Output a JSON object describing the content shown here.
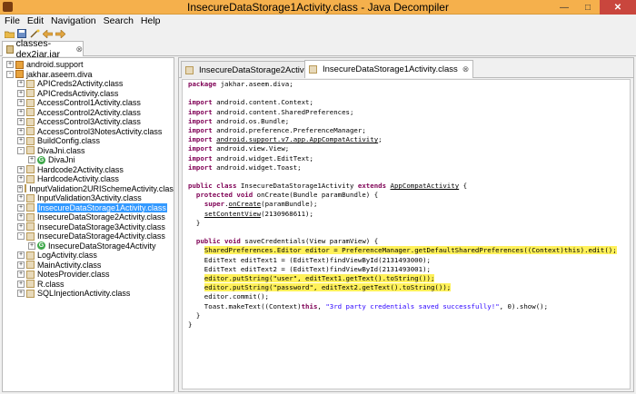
{
  "window": {
    "title": "InsecureDataStorage1Activity.class - Java Decompiler"
  },
  "menu": [
    "File",
    "Edit",
    "Navigation",
    "Search",
    "Help"
  ],
  "file_tab": {
    "label": "classes-dex2jar.jar"
  },
  "tree": [
    {
      "label": "android.support",
      "type": "package",
      "depth": 0,
      "expander": "+"
    },
    {
      "label": "jakhar.aseem.diva",
      "type": "package",
      "depth": 0,
      "expander": "-"
    },
    {
      "label": "APICreds2Activity.class",
      "type": "class",
      "depth": 1,
      "expander": "+"
    },
    {
      "label": "APICredsActivity.class",
      "type": "class",
      "depth": 1,
      "expander": "+"
    },
    {
      "label": "AccessControl1Activity.class",
      "type": "class",
      "depth": 1,
      "expander": "+"
    },
    {
      "label": "AccessControl2Activity.class",
      "type": "class",
      "depth": 1,
      "expander": "+"
    },
    {
      "label": "AccessControl3Activity.class",
      "type": "class",
      "depth": 1,
      "expander": "+"
    },
    {
      "label": "AccessControl3NotesActivity.class",
      "type": "class",
      "depth": 1,
      "expander": "+"
    },
    {
      "label": "BuildConfig.class",
      "type": "class",
      "depth": 1,
      "expander": "+"
    },
    {
      "label": "DivaJni.class",
      "type": "class",
      "depth": 1,
      "expander": "-"
    },
    {
      "label": "DivaJni",
      "type": "g",
      "depth": 2,
      "expander": "+"
    },
    {
      "label": "Hardcode2Activity.class",
      "type": "class",
      "depth": 1,
      "expander": "+"
    },
    {
      "label": "HardcodeActivity.class",
      "type": "class",
      "depth": 1,
      "expander": "+"
    },
    {
      "label": "InputValidation2URISchemeActivity.class",
      "type": "class",
      "depth": 1,
      "expander": "+"
    },
    {
      "label": "InputValidation3Activity.class",
      "type": "class",
      "depth": 1,
      "expander": "+"
    },
    {
      "label": "InsecureDataStorage1Activity.class",
      "type": "class",
      "depth": 1,
      "expander": "+",
      "selected": true
    },
    {
      "label": "InsecureDataStorage2Activity.class",
      "type": "class",
      "depth": 1,
      "expander": "+"
    },
    {
      "label": "InsecureDataStorage3Activity.class",
      "type": "class",
      "depth": 1,
      "expander": "+"
    },
    {
      "label": "InsecureDataStorage4Activity.class",
      "type": "class",
      "depth": 1,
      "expander": "-"
    },
    {
      "label": "InsecureDataStorage4Activity",
      "type": "g",
      "depth": 2,
      "expander": "+"
    },
    {
      "label": "LogActivity.class",
      "type": "class",
      "depth": 1,
      "expander": "+"
    },
    {
      "label": "MainActivity.class",
      "type": "class",
      "depth": 1,
      "expander": "+"
    },
    {
      "label": "NotesProvider.class",
      "type": "class",
      "depth": 1,
      "expander": "+"
    },
    {
      "label": "R.class",
      "type": "class",
      "depth": 1,
      "expander": "+"
    },
    {
      "label": "SQLInjectionActivity.class",
      "type": "class",
      "depth": 1,
      "expander": "+"
    }
  ],
  "editor_tabs": [
    {
      "label": "InsecureDataStorage2Activity.class",
      "active": false
    },
    {
      "label": "InsecureDataStorage1Activity.class",
      "active": true
    }
  ],
  "code_lines": [
    [
      {
        "t": "package",
        "k": "kw"
      },
      {
        "t": " jakhar.aseem.diva;"
      }
    ],
    [],
    [
      {
        "t": "import",
        "k": "kw"
      },
      {
        "t": " android.content.Context;"
      }
    ],
    [
      {
        "t": "import",
        "k": "kw"
      },
      {
        "t": " android.content.SharedPreferences;"
      }
    ],
    [
      {
        "t": "import",
        "k": "kw"
      },
      {
        "t": " android.os.Bundle;"
      }
    ],
    [
      {
        "t": "import",
        "k": "kw"
      },
      {
        "t": " android.preference.PreferenceManager;"
      }
    ],
    [
      {
        "t": "import",
        "k": "kw"
      },
      {
        "t": " "
      },
      {
        "t": "android.support.v7.app.AppCompatActivity",
        "k": "lnk"
      },
      {
        "t": ";"
      }
    ],
    [
      {
        "t": "import",
        "k": "kw"
      },
      {
        "t": " android.view.View;"
      }
    ],
    [
      {
        "t": "import",
        "k": "kw"
      },
      {
        "t": " android.widget.EditText;"
      }
    ],
    [
      {
        "t": "import",
        "k": "kw"
      },
      {
        "t": " android.widget.Toast;"
      }
    ],
    [],
    [
      {
        "t": "public class",
        "k": "kw"
      },
      {
        "t": " InsecureDataStorage1Activity "
      },
      {
        "t": "extends",
        "k": "kw"
      },
      {
        "t": " "
      },
      {
        "t": "AppCompatActivity",
        "k": "lnk"
      },
      {
        "t": " {"
      }
    ],
    [
      {
        "t": "  "
      },
      {
        "t": "protected void",
        "k": "kw"
      },
      {
        "t": " onCreate(Bundle paramBundle) {"
      }
    ],
    [
      {
        "t": "    "
      },
      {
        "t": "super",
        "k": "kw"
      },
      {
        "t": "."
      },
      {
        "t": "onCreate",
        "k": "lnk"
      },
      {
        "t": "(paramBundle);"
      }
    ],
    [
      {
        "t": "    "
      },
      {
        "t": "setContentView",
        "k": "lnk"
      },
      {
        "t": "(2130968611);"
      }
    ],
    [
      {
        "t": "  }"
      }
    ],
    [],
    [
      {
        "t": "  "
      },
      {
        "t": "public void",
        "k": "kw"
      },
      {
        "t": " saveCredentials(View paramView) {"
      }
    ],
    [
      {
        "t": "    "
      },
      {
        "t": "SharedPreferences.Editor editor = PreferenceManager.getDefaultSharedPreferences((Context)this).edit();",
        "k": "hl"
      }
    ],
    [
      {
        "t": "    EditText editText1 = (EditText)findViewById(2131493000);"
      }
    ],
    [
      {
        "t": "    EditText editText2 = (EditText)findViewById(2131493001);"
      }
    ],
    [
      {
        "t": "    "
      },
      {
        "t": "editor.putString(\"user\", editText1.getText().toString());",
        "k": "hl"
      }
    ],
    [
      {
        "t": "    "
      },
      {
        "t": "editor.putString(\"password\", editText2.getText().toString());",
        "k": "hl"
      }
    ],
    [
      {
        "t": "    editor.commit();"
      }
    ],
    [
      {
        "t": "    Toast.makeText((Context)"
      },
      {
        "t": "this",
        "k": "kw"
      },
      {
        "t": ", "
      },
      {
        "t": "\"3rd party credentials saved successfully!\"",
        "k": "str"
      },
      {
        "t": ", 0).show();"
      }
    ],
    [
      {
        "t": "  }"
      }
    ],
    [
      {
        "t": "}"
      }
    ]
  ]
}
